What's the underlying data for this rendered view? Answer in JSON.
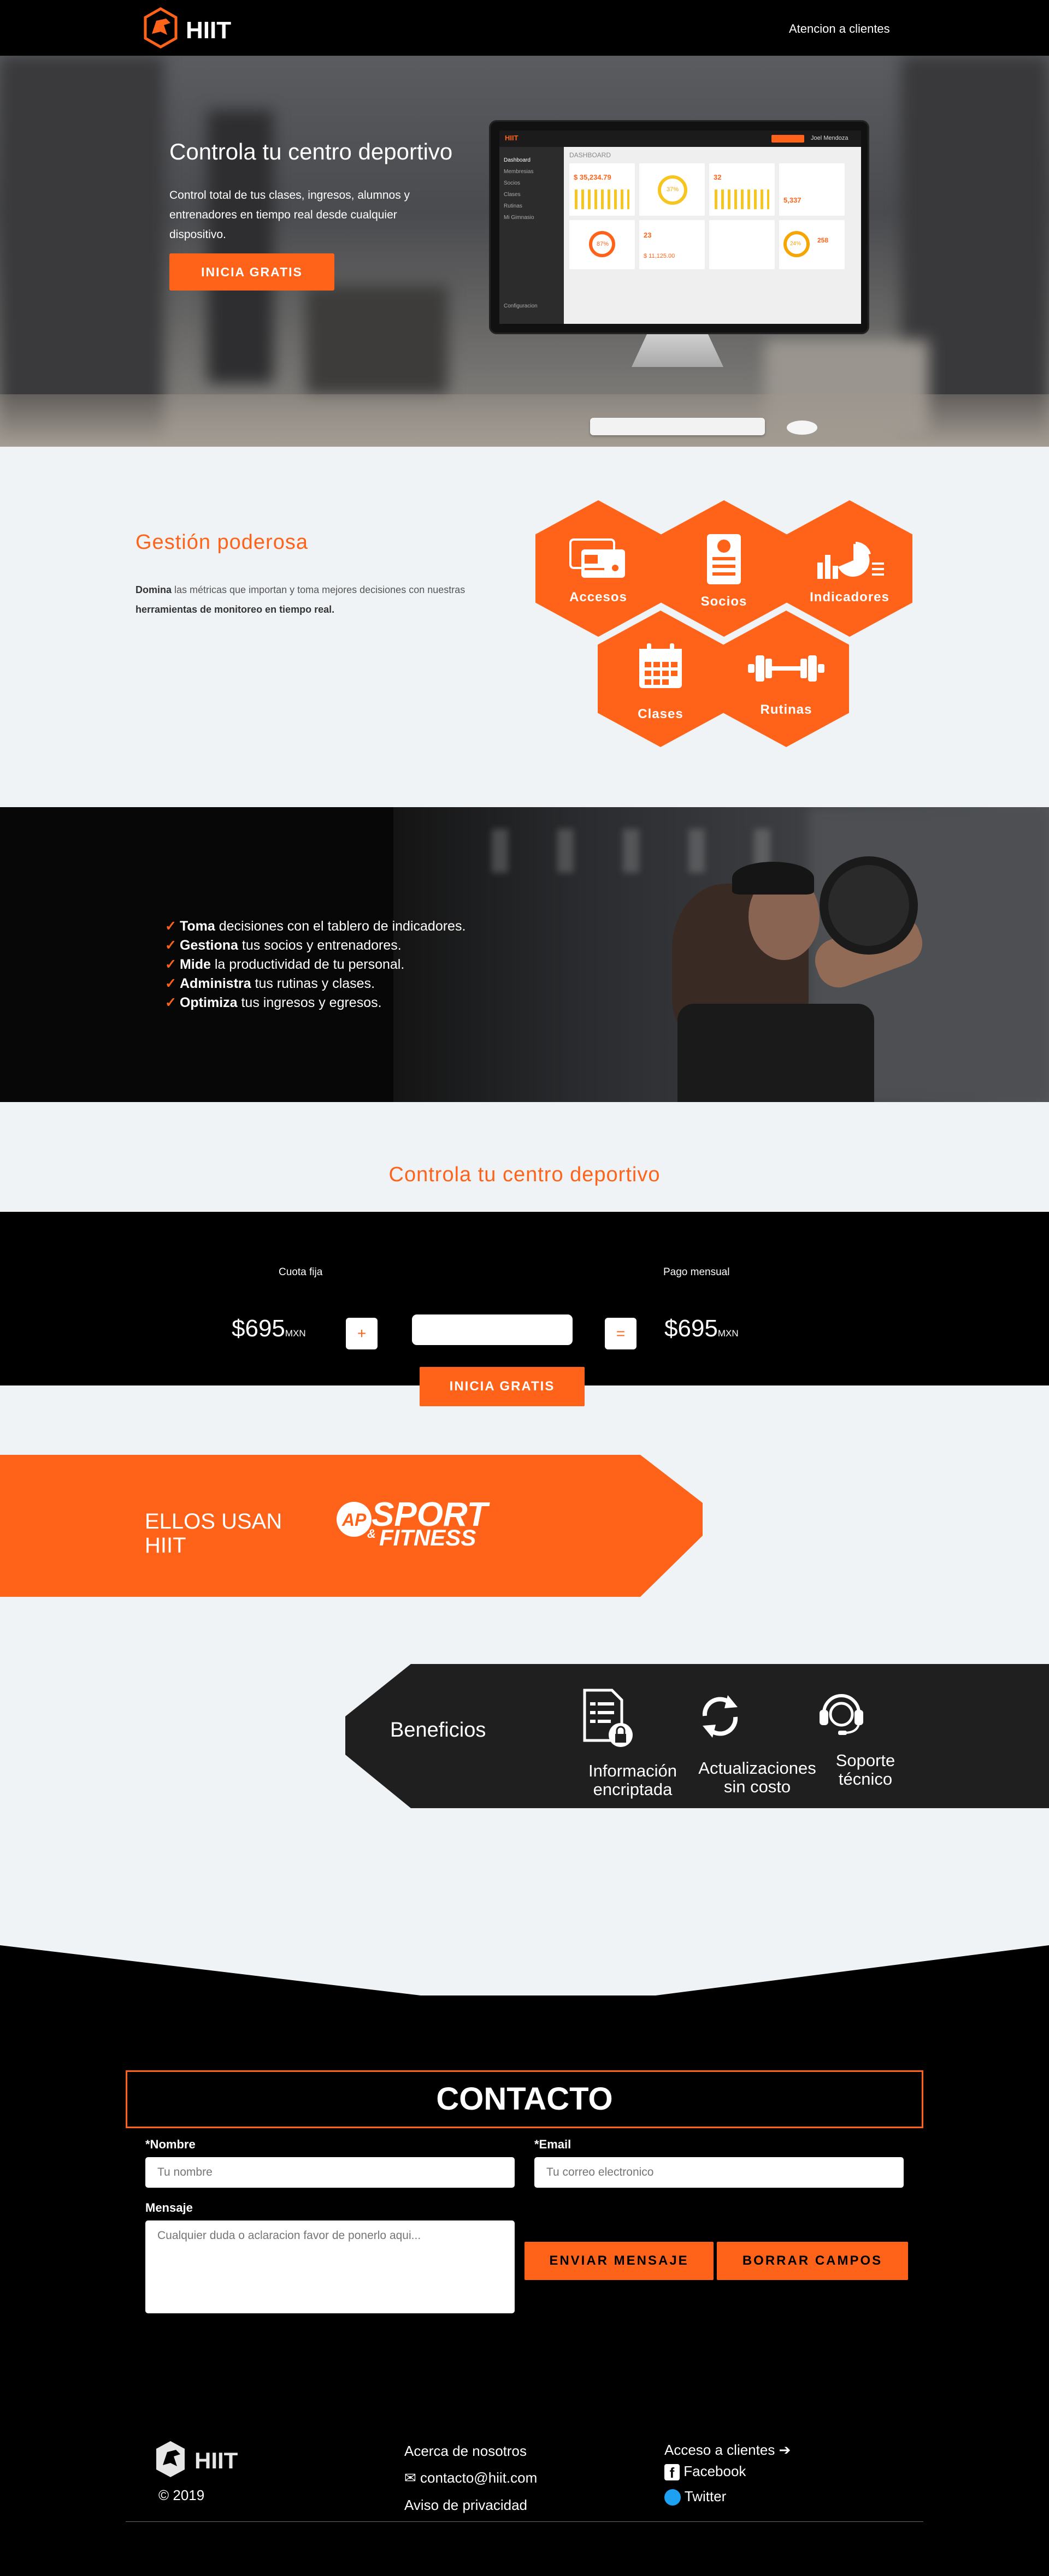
{
  "brand": {
    "name": "HIIT",
    "accent": "#ff6319"
  },
  "header": {
    "nav_support": "Atencion a clientes"
  },
  "hero": {
    "title": "Controla tu centro deportivo",
    "description": "Control total de tus clases, ingresos, alumnos y entrenadores en tiempo real desde cualquier dispositivo.",
    "cta": "INICIA GRATIS"
  },
  "dashboard": {
    "header": "DASHBOARD",
    "sidebar": [
      "Dashboard",
      "Membresias",
      "Socios",
      "Clases",
      "Rutinas",
      "Mi Gimnasio",
      "Configuracion"
    ],
    "user": "Joel Mendoza",
    "cards": [
      "$ 35,234.79",
      "37%",
      "32",
      "5,337",
      "87%",
      "23",
      "$ 11,125.00",
      "24%",
      "258"
    ]
  },
  "features_section": {
    "title": "Gestión poderosa",
    "desc_bold1": "Domina",
    "desc_mid": " las métricas que importan y toma mejores decisiones con nuestras ",
    "desc_bold2": "herramientas de monitoreo en tiempo real.",
    "hexes": [
      "Accesos",
      "Socios",
      "Indicadores",
      "Clases",
      "Rutinas"
    ]
  },
  "bullets": [
    {
      "bold": "Toma",
      "rest": " decisiones con el tablero de indicadores."
    },
    {
      "bold": "Gestiona",
      "rest": " tus socios y entrenadores."
    },
    {
      "bold": "Mide",
      "rest": " la productividad de tu personal."
    },
    {
      "bold": "Administra",
      "rest": " tus rutinas y clases."
    },
    {
      "bold": "Optimiza",
      "rest": " tus ingresos y egresos."
    }
  ],
  "pricing": {
    "title": "Controla tu centro deportivo",
    "fixed_label": "Cuota fija",
    "fixed_price": "$695",
    "monthly_label": "Pago mensual",
    "monthly_price": "$695",
    "currency": "MXN",
    "plus": "+",
    "equals": "=",
    "cta": "INICIA GRATIS"
  },
  "clients": {
    "title": "ELLOS USAN HIIT",
    "logo_top": "SPORT",
    "logo_bottom": "FITNESS",
    "logo_mark": "AP",
    "logo_amp": "&"
  },
  "benefits": {
    "title": "Beneficios",
    "items": [
      "Información encriptada",
      "Actualizaciones sin costo",
      "Soporte técnico"
    ]
  },
  "contact": {
    "title": "CONTACTO",
    "name_label": "*Nombre",
    "name_placeholder": "Tu nombre",
    "email_label": "*Email",
    "email_placeholder": "Tu correo electronico",
    "message_label": "Mensaje",
    "message_placeholder": "Cualquier duda o aclaracion favor de ponerlo aqui...",
    "send": "ENVIAR MENSAJE",
    "clear": "BORRAR CAMPOS"
  },
  "footer": {
    "copyright": "© 2019",
    "about": "Acerca de nosotros",
    "email": "contacto@hiit.com",
    "privacy": "Aviso de privacidad",
    "client_access": "Acceso a clientes ➔",
    "facebook": "Facebook",
    "twitter": "Twitter"
  }
}
